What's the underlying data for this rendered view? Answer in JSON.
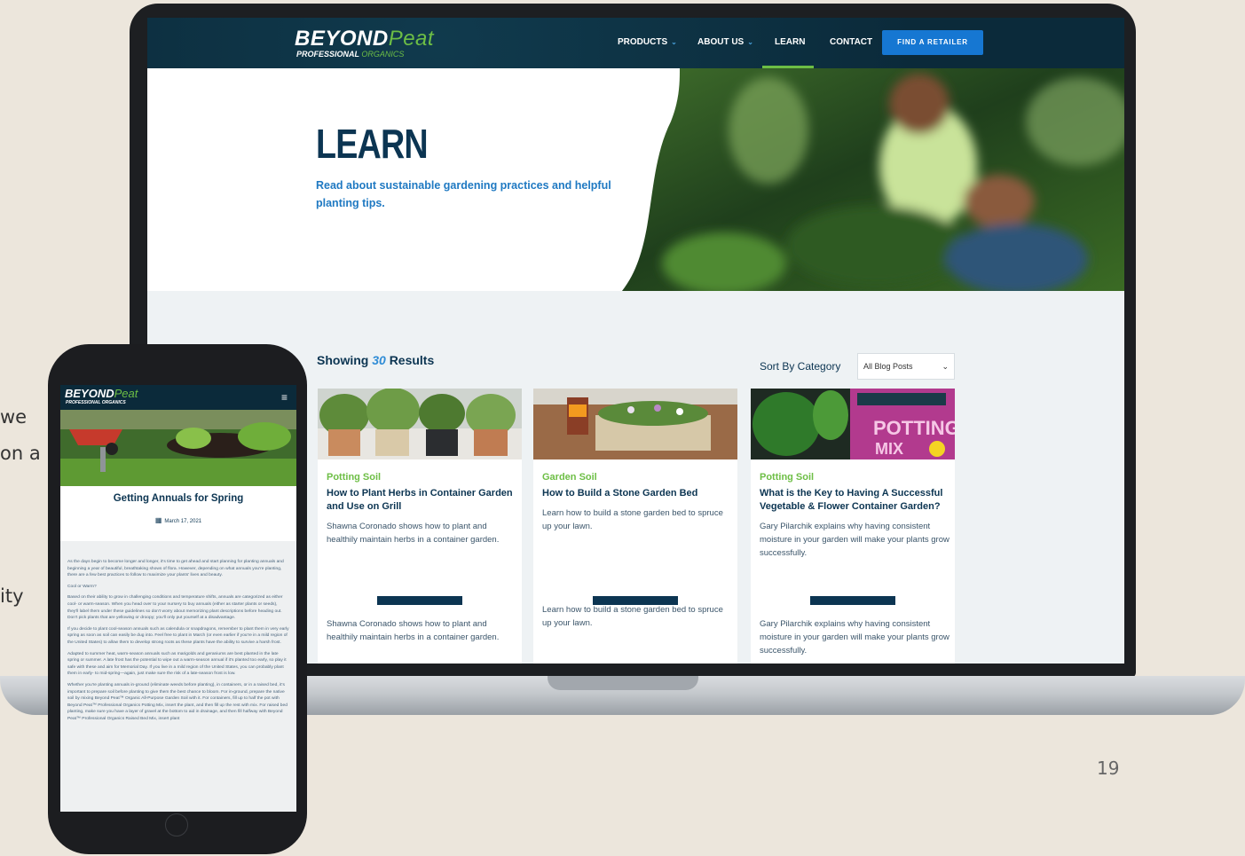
{
  "slide": {
    "side_text": [
      "we",
      "on a",
      "ity"
    ],
    "page_number": "19"
  },
  "site": {
    "logo": {
      "be": "BEYOND",
      "peat": "Peat",
      "sub1": "PROFESSIONAL",
      "sub2": "ORGANICS"
    },
    "nav": [
      {
        "label": "PRODUCTS",
        "has_dropdown": true
      },
      {
        "label": "ABOUT US",
        "has_dropdown": true
      },
      {
        "label": "LEARN",
        "has_dropdown": false,
        "active": true
      },
      {
        "label": "CONTACT",
        "has_dropdown": false
      }
    ],
    "cta": "FIND A RETAILER",
    "hero": {
      "title": "LEARN",
      "description": "Read about sustainable gardening practices and helpful planting tips."
    },
    "results": {
      "prefix": "Showing",
      "count": "30",
      "suffix": "Results"
    },
    "sort": {
      "label": "Sort By Category",
      "selected": "All Blog Posts"
    },
    "cards": [
      {
        "category": "Potting Soil",
        "title": "How to Plant Herbs in Container Garden and Use on Grill",
        "description": "Shawna Coronado shows how to plant and healthily maintain herbs in a container garden.",
        "description_repeat": "Shawna Coronado shows how to plant and healthily maintain herbs in a container garden."
      },
      {
        "category": "Garden Soil",
        "title": "How to Build a Stone Garden Bed",
        "description": "Learn how to build a stone garden bed to spruce up your lawn.",
        "description_repeat": "Learn how to build a stone garden bed to spruce up your lawn."
      },
      {
        "category": "Potting Soil",
        "title": "What is the Key to Having A Successful Vegetable & Flower Container Garden?",
        "description": "Gary Pilarchik explains why having consistent moisture in your garden will make your plants grow successfully.",
        "description_repeat": "Gary Pilarchik explains why having consistent moisture in your garden will make your plants grow successfully."
      }
    ],
    "colors": {
      "navy": "#0c3552",
      "green": "#6dbe45",
      "blue": "#1677d2"
    }
  },
  "phone": {
    "logo": {
      "be": "BEYOND",
      "peat": "Peat",
      "sub": "PROFESSIONAL ORGANICS"
    },
    "menu_icon": "hamburger-icon",
    "post_title": "Getting Annuals for Spring",
    "post_date": "March 17, 2021",
    "paragraphs": [
      "As the days begin to become longer and longer, it's time to get ahead and start planning for planting annuals and beginning a year of beautiful, breathtaking shows of flora. However, depending on what annuals you're planting, there are a few best practices to follow to maximize your plants' lives and beauty.",
      "Cool or Warm?",
      "Based on their ability to grow in challenging conditions and temperature shifts, annuals are categorized as either cool- or warm-season. When you head over to your nursery to buy annuals (either as starter plants or seeds), they'll label them under these guidelines so don't worry about memorizing plant descriptions before heading out. Don't pick plants that are yellowing or droopy; you'll only put yourself at a disadvantage.",
      "If you decide to plant cool-season annuals such as calendula or snapdragons, remember to plant them in very early spring as soon as soil can easily be dug into. Feel free to plant in March (or even earlier if you're in a mild region of the United States) to allow them to develop strong roots as these plants have the ability to survive a harsh frost.",
      "Adapted to summer heat, warm-season annuals such as marigolds and geraniums are best planted in the late spring or summer. A late frost has the potential to wipe out a warm-season annual if it's planted too early, so play it safe with these and aim for Memorial Day. If you live in a mild region of the United States, you can probably plant them in early- to mid-spring—again, just make sure the risk of a late-season frost is low.",
      "Whether you're planting annuals in-ground (eliminate weeds before planting), in containers, or in a raised bed, it's important to prepare soil before planting to give them the best chance to bloom. For in-ground, prepare the native soil by mixing Beyond Peat™ Organic All-Purpose Garden Soil with it. For containers, fill up to half the pot with Beyond Peat™ Professional Organics Potting Mix, insert the plant, and then fill up the rest with mix. For raised bed planting, make sure you have a layer of gravel at the bottom to aid in drainage, and then fill halfway with Beyond Peat™ Professional Organics Raised Bed Mix, insert plant"
    ]
  }
}
